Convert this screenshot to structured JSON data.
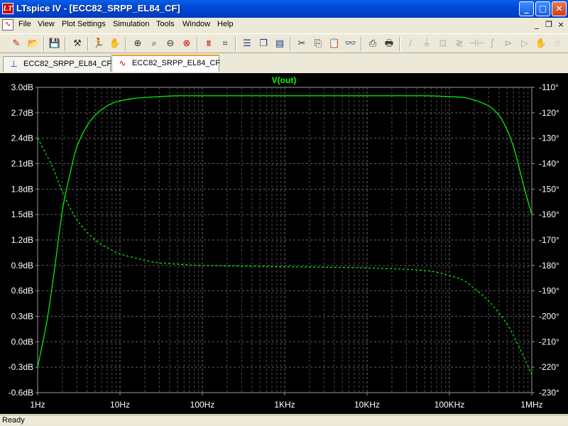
{
  "window": {
    "title": "LTspice IV - [ECC82_SRPP_EL84_CF]",
    "buttons": {
      "minimize": "_",
      "maximize": "□",
      "close": "✕"
    }
  },
  "menu": {
    "items": [
      "File",
      "View",
      "Plot Settings",
      "Simulation",
      "Tools",
      "Window",
      "Help"
    ],
    "mdi_buttons": {
      "minimize": "_",
      "restore": "❐",
      "close": "×"
    }
  },
  "tabs": [
    {
      "label": "ECC82_SRPP_EL84_CF",
      "icon": "schematic-icon",
      "active": false
    },
    {
      "label": "ECC82_SRPP_EL84_CF",
      "icon": "waveform-icon",
      "active": true
    }
  ],
  "plot": {
    "trace_name": "V(out)",
    "colors": {
      "background": "#000000",
      "grid": "#7f7f7f",
      "trace": "#00ff00",
      "axis_text": "#ffffff"
    }
  },
  "chart_data": {
    "type": "line",
    "title": "V(out)",
    "x_scale": "log",
    "x_ticks": [
      "1Hz",
      "10Hz",
      "100Hz",
      "1KHz",
      "10KHz",
      "100KHz",
      "1MHz"
    ],
    "xlim_hz": [
      1,
      1000000
    ],
    "y_left_ticks": [
      "3.0dB",
      "2.7dB",
      "2.4dB",
      "2.1dB",
      "1.8dB",
      "1.5dB",
      "1.2dB",
      "0.9dB",
      "0.6dB",
      "0.3dB",
      "0.0dB",
      "-0.3dB",
      "-0.6dB"
    ],
    "y_left_lim_db": [
      -0.6,
      3.0
    ],
    "y_right_ticks": [
      "-110°",
      "-120°",
      "-130°",
      "-140°",
      "-150°",
      "-160°",
      "-170°",
      "-180°",
      "-190°",
      "-200°",
      "-210°",
      "-220°",
      "-230°"
    ],
    "y_right_lim_deg": [
      -230,
      -110
    ],
    "grid": true,
    "series": [
      {
        "name": "V(out)",
        "role": "magnitude",
        "style": "solid",
        "x": [
          1,
          1.3,
          1.6,
          2,
          2.5,
          3,
          4,
          5,
          6,
          8,
          10,
          15,
          20,
          30,
          50,
          100,
          1000,
          10000,
          50000,
          100000,
          150000,
          200000,
          300000,
          400000,
          500000,
          600000,
          700000,
          800000,
          1000000
        ],
        "y": [
          -0.3,
          0.25,
          0.85,
          1.55,
          2.0,
          2.3,
          2.55,
          2.67,
          2.74,
          2.81,
          2.84,
          2.87,
          2.88,
          2.89,
          2.9,
          2.9,
          2.9,
          2.9,
          2.9,
          2.89,
          2.88,
          2.85,
          2.78,
          2.67,
          2.5,
          2.3,
          2.06,
          1.83,
          1.5
        ]
      },
      {
        "role": "phase",
        "style": "dashed",
        "axis": "right",
        "x": [
          1,
          1.5,
          2,
          3,
          5,
          8,
          10,
          20,
          30,
          50,
          100,
          1000,
          10000,
          50000,
          100000,
          150000,
          200000,
          300000,
          500000,
          700000,
          1000000
        ],
        "y": [
          -130,
          -141,
          -151,
          -162,
          -170,
          -174,
          -175.5,
          -178,
          -179,
          -179.5,
          -180,
          -180.5,
          -181,
          -182,
          -184,
          -186,
          -189,
          -194,
          -203,
          -212,
          -223
        ]
      }
    ]
  },
  "status": {
    "text": "Ready"
  }
}
